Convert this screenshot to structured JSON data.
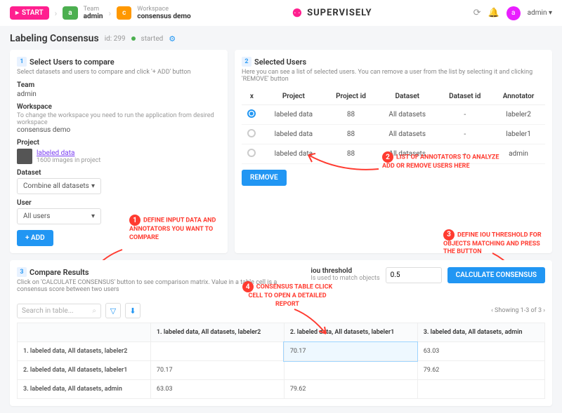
{
  "topbar": {
    "start": "START",
    "team_label": "Team",
    "team": "admin",
    "ws_label": "Workspace",
    "ws": "consensus demo",
    "brand": "SUPERVISELY",
    "user": "admin"
  },
  "page": {
    "title": "Labeling Consensus",
    "id": "id: 299",
    "status": "started"
  },
  "select": {
    "title": "Select Users to compare",
    "desc": "Select datasets and users to compare and click '+ ADD' button",
    "team_l": "Team",
    "team": "admin",
    "ws_l": "Workspace",
    "ws_hint": "To change the workspace you need to run the application from desired workspace",
    "ws": "consensus demo",
    "proj_l": "Project",
    "proj": "labeled data",
    "proj_sub": "1600 images in project",
    "ds_l": "Dataset",
    "ds": "Combine all datasets",
    "user_l": "User",
    "user": "All users",
    "add": "+  ADD"
  },
  "selected": {
    "title": "Selected Users",
    "desc": "Here you can see a list of selected users. You can remove a user from the list by selecting it and clicking 'REMOVE' button",
    "cols": [
      "x",
      "Project",
      "Project id",
      "Dataset",
      "Dataset id",
      "Annotator"
    ],
    "rows": [
      {
        "on": true,
        "project": "labeled data",
        "pid": "88",
        "ds": "All datasets",
        "did": "-",
        "ann": "labeler2"
      },
      {
        "on": false,
        "project": "labeled data",
        "pid": "88",
        "ds": "All datasets",
        "did": "-",
        "ann": "labeler1"
      },
      {
        "on": false,
        "project": "labeled data",
        "pid": "88",
        "ds": "All datasets",
        "did": "-",
        "ann": "admin"
      }
    ],
    "remove": "REMOVE"
  },
  "results": {
    "title": "Compare Results",
    "desc": "Click on 'CALCULATE CONSENSUS' button to see comparison matrix. Value in a table cell is a consensus score between two users",
    "iou_l": "iou threshold",
    "iou_sub": "Is used to match objects",
    "iou_v": "0.5",
    "calc": "CALCULATE CONSENSUS",
    "search": "Search in table...",
    "paging": "Showing 1-3 of 3",
    "headers": [
      "",
      "1. labeled data, All datasets, labeler2",
      "2. labeled data, All datasets, labeler1",
      "3. labeled data, All datasets, admin"
    ],
    "matrix": [
      [
        "1. labeled data, All datasets, labeler2",
        "",
        "70.17",
        "63.03"
      ],
      [
        "2. labeled data, All datasets, labeler1",
        "70.17",
        "",
        "79.62"
      ],
      [
        "3. labeled data, All datasets, admin",
        "63.03",
        "79.62",
        ""
      ]
    ]
  },
  "hints": {
    "h1": "DEFINE INPUT DATA AND ANNOTATORS YOU WANT TO COMPARE",
    "h2": "LIST OF ANNOTATORS TO ANALYZE ADD OR REMOVE USERS HERE",
    "h3": "DEFINE IOU THRESHOLD FOR OBJECTS MATCHING AND PRESS THE BUTTON",
    "h4": "CONSENSUS TABLE CLICK CELL TO OPEN A DETAILED REPORT"
  }
}
